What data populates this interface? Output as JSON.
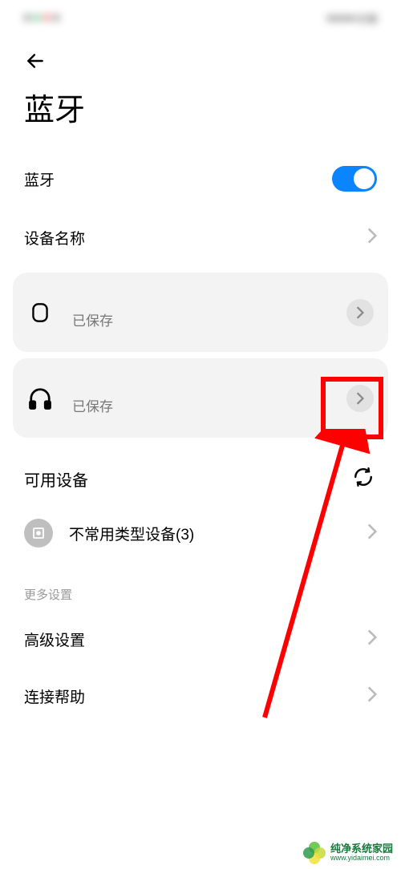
{
  "page": {
    "title": "蓝牙"
  },
  "settings": {
    "bluetooth_label": "蓝牙",
    "bluetooth_on": true,
    "device_name_label": "设备名称"
  },
  "saved_devices": [
    {
      "icon": "watch",
      "status": "已保存"
    },
    {
      "icon": "headphones",
      "status": "已保存"
    }
  ],
  "available": {
    "header": "可用设备",
    "uncommon_label": "不常用类型设备(3)"
  },
  "more": {
    "header": "更多设置",
    "advanced": "高级设置",
    "help": "连接帮助"
  },
  "watermark": {
    "cn": "纯净系统家园",
    "url": "www.yidaimei.com"
  },
  "colors": {
    "accent": "#0b84ff",
    "annotation": "#ff0000"
  }
}
